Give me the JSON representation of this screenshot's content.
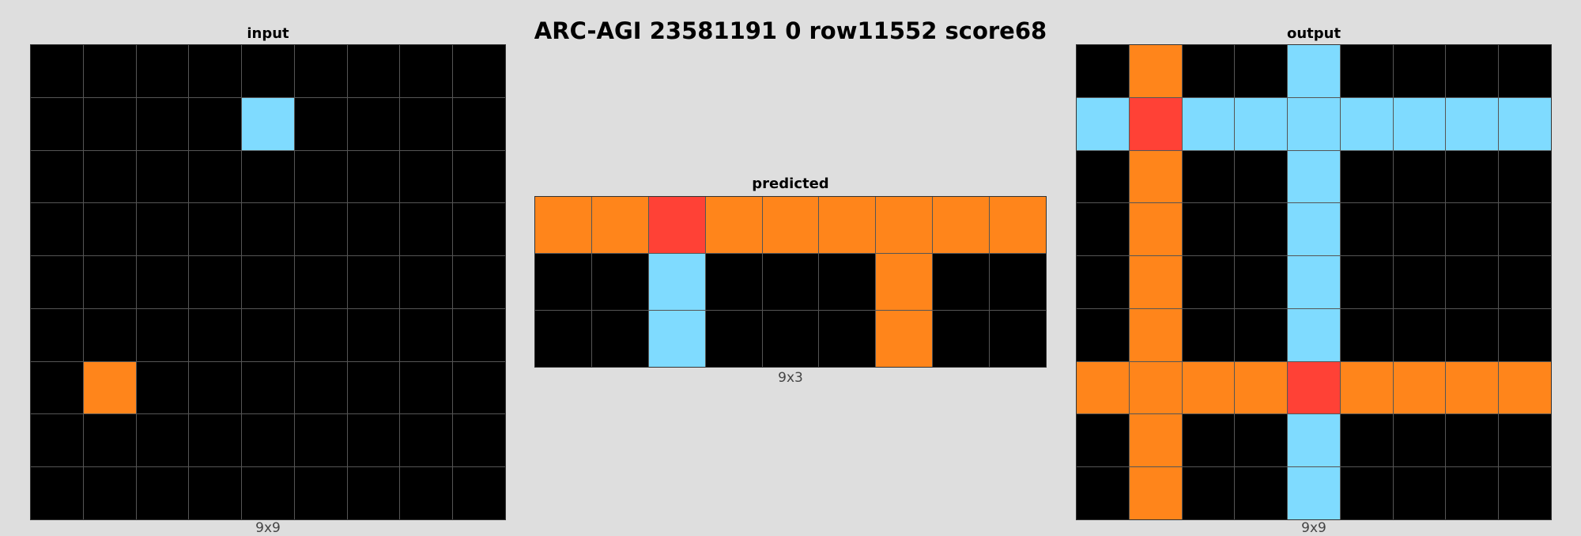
{
  "title": "ARC-AGI 23581191 0 row11552 score68",
  "colors": {
    "0": "#000000",
    "2": "#ff4136",
    "7": "#ff851b",
    "8": "#7fdbff"
  },
  "panels": {
    "input": {
      "label": "input",
      "dims": "9x9",
      "cols": 9,
      "rows": 9,
      "grid": [
        [
          0,
          0,
          0,
          0,
          0,
          0,
          0,
          0,
          0
        ],
        [
          0,
          0,
          0,
          0,
          8,
          0,
          0,
          0,
          0
        ],
        [
          0,
          0,
          0,
          0,
          0,
          0,
          0,
          0,
          0
        ],
        [
          0,
          0,
          0,
          0,
          0,
          0,
          0,
          0,
          0
        ],
        [
          0,
          0,
          0,
          0,
          0,
          0,
          0,
          0,
          0
        ],
        [
          0,
          0,
          0,
          0,
          0,
          0,
          0,
          0,
          0
        ],
        [
          0,
          7,
          0,
          0,
          0,
          0,
          0,
          0,
          0
        ],
        [
          0,
          0,
          0,
          0,
          0,
          0,
          0,
          0,
          0
        ],
        [
          0,
          0,
          0,
          0,
          0,
          0,
          0,
          0,
          0
        ]
      ]
    },
    "predicted": {
      "label": "predicted",
      "dims": "9x3",
      "cols": 9,
      "rows": 3,
      "grid": [
        [
          7,
          7,
          2,
          7,
          7,
          7,
          7,
          7,
          7
        ],
        [
          0,
          0,
          8,
          0,
          0,
          0,
          7,
          0,
          0
        ],
        [
          0,
          0,
          8,
          0,
          0,
          0,
          7,
          0,
          0
        ]
      ]
    },
    "output": {
      "label": "output",
      "dims": "9x9",
      "cols": 9,
      "rows": 9,
      "grid": [
        [
          0,
          7,
          0,
          0,
          8,
          0,
          0,
          0,
          0
        ],
        [
          8,
          2,
          8,
          8,
          8,
          8,
          8,
          8,
          8
        ],
        [
          0,
          7,
          0,
          0,
          8,
          0,
          0,
          0,
          0
        ],
        [
          0,
          7,
          0,
          0,
          8,
          0,
          0,
          0,
          0
        ],
        [
          0,
          7,
          0,
          0,
          8,
          0,
          0,
          0,
          0
        ],
        [
          0,
          7,
          0,
          0,
          8,
          0,
          0,
          0,
          0
        ],
        [
          7,
          7,
          7,
          7,
          2,
          7,
          7,
          7,
          7
        ],
        [
          0,
          7,
          0,
          0,
          8,
          0,
          0,
          0,
          0
        ],
        [
          0,
          7,
          0,
          0,
          8,
          0,
          0,
          0,
          0
        ]
      ]
    }
  }
}
